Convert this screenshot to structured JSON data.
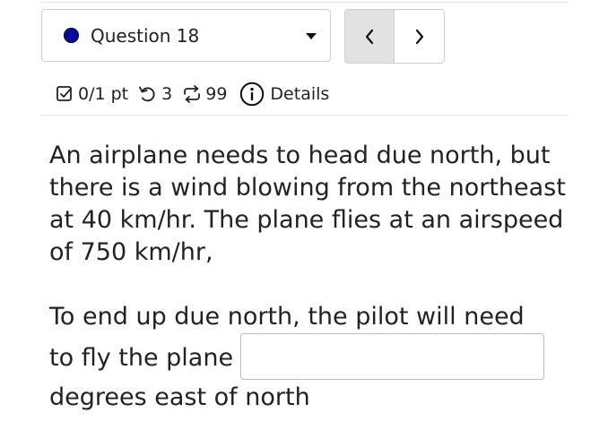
{
  "question_selector": {
    "label": "Question 18",
    "status_color": "#0a0a9c"
  },
  "nav": {
    "prev_icon": "chevron-left-icon",
    "next_icon": "chevron-right-icon"
  },
  "meta": {
    "score": "0/1 pt",
    "attempts": "3",
    "submissions": "99",
    "details_label": "Details",
    "icons": [
      "checkbox-icon",
      "retry-icon",
      "repeat-icon",
      "info-icon"
    ]
  },
  "question": {
    "text": "An airplane needs to head due north, but there is a wind blowing from the northeast at 40 km/hr. The plane flies at an airspeed of 750 km/hr,",
    "prompt_line1": "To end up due north, the pilot will need",
    "prompt_before_input": "to fly the plane",
    "prompt_after_input": "degrees east of north",
    "answer_value": ""
  }
}
